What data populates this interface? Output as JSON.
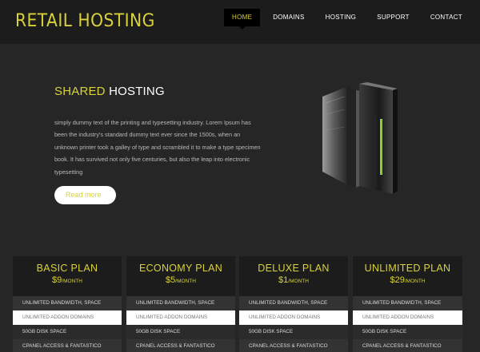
{
  "brand": "RETAIL HOSTING",
  "nav": [
    "HOME",
    "DOMAINS",
    "HOSTING",
    "SUPPORT",
    "CONTACT"
  ],
  "active_nav": "HOME",
  "hero": {
    "title_highlight": "SHARED",
    "title_rest": "HOSTING",
    "body": "simply dummy text of the printing and typesetting industry. Lorem Ipsum has been the industry's standard dummy text ever since the 1500s, when an unknown printer took a galley of type and scrambled it to make a type specimen book. It has survived not only five centuries, but also the leap into electronic typesetting",
    "cta": "Read more"
  },
  "plans": [
    {
      "name": "BASIC PLAN",
      "price": "$9",
      "per": "/MONTH",
      "features": [
        "UNLIMITED BANDWIDTH, SPACE",
        "UNLIMITED ADDON DOMAINS",
        "50GB DISK SPACE",
        "CPANEL ACCESS & FANTASTICO"
      ]
    },
    {
      "name": "ECONOMY PLAN",
      "price": "$5",
      "per": "/MONTH",
      "features": [
        "UNLIMITED BANDWIDTH, SPACE",
        "UNLIMITED ADDON DOMAINS",
        "50GB DISK SPACE",
        "CPANEL ACCESS & FANTASTICO"
      ]
    },
    {
      "name": "DELUXE PLAN",
      "price": "$1",
      "per": "/MONTH",
      "features": [
        "UNLIMITED BANDWIDTH, SPACE",
        "UNLIMITED ADDON DOMAINS",
        "50GB DISK SPACE",
        "CPANEL ACCESS & FANTASTICO"
      ]
    },
    {
      "name": "UNLIMITED PLAN",
      "price": "$29",
      "per": "/MONTH",
      "features": [
        "UNLIMITED BANDWIDTH, SPACE",
        "UNLIMITED ADDON DOMAINS",
        "50GB DISK SPACE",
        "CPANEL ACCESS & FANTASTICO"
      ]
    }
  ],
  "colors": {
    "accent": "#d9d23a",
    "header_bg": "#1c1c1c",
    "page_bg": "#262626",
    "server_glow": "#8fcf2a"
  },
  "icons": {
    "hero_image": "server-tower-icon"
  }
}
